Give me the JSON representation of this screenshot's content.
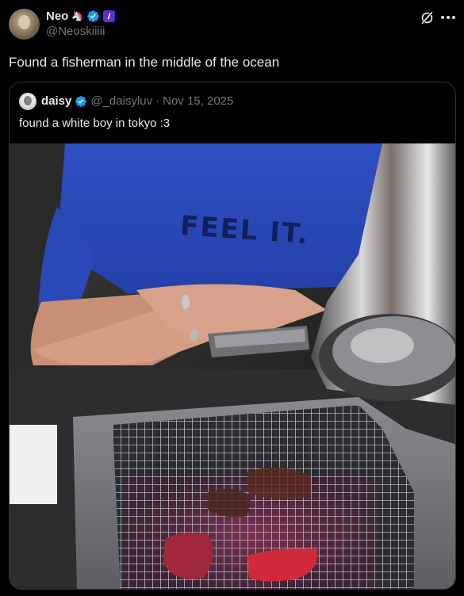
{
  "tweet": {
    "display_name": "Neo",
    "name_emoji": "🦄",
    "badge_label": "",
    "handle": "@Neoskiiiii",
    "text": "Found a fisherman in the middle of the ocean"
  },
  "quoted": {
    "display_name": "daisy",
    "handle": "@_daisyluv",
    "separator": "·",
    "date": "Nov 15, 2025",
    "text": "found a white boy in tokyo :3",
    "shirt_text": "FEEL IT."
  },
  "icons": {
    "grok": "grok-icon",
    "more": "more-icon",
    "verified": "verified-badge-icon"
  },
  "colors": {
    "background": "#000000",
    "text": "#e7e9ea",
    "muted": "#71767b",
    "verified": "#1d9bf0",
    "border": "#2f3336"
  }
}
